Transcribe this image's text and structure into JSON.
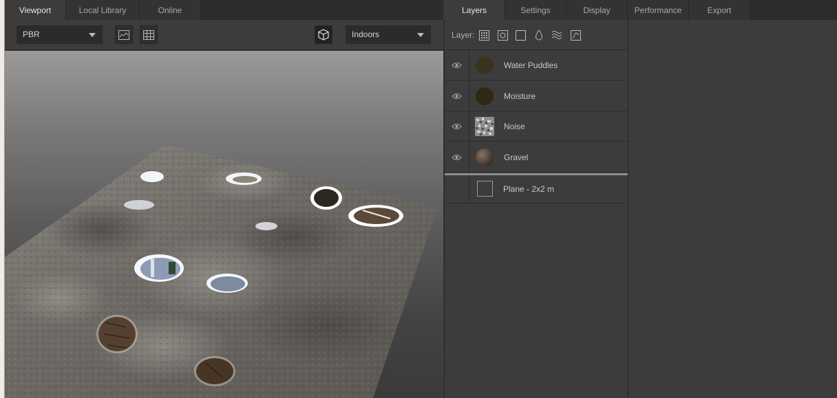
{
  "viewport_tabs": [
    {
      "label": "Viewport",
      "active": true
    },
    {
      "label": "Local Library",
      "active": false
    },
    {
      "label": "Online",
      "active": false
    }
  ],
  "toolbar": {
    "shading_mode": "PBR",
    "environment": "Indoors"
  },
  "right_tabs": [
    {
      "label": "Layers",
      "active": true
    },
    {
      "label": "Settings",
      "active": false
    },
    {
      "label": "Display",
      "active": false
    },
    {
      "label": "Performance",
      "active": false
    },
    {
      "label": "Export",
      "active": false
    }
  ],
  "layers": {
    "tools_label": "Layer:",
    "items": [
      {
        "name": "Water Puddles",
        "visible": true,
        "thumb_color": "#3b3320"
      },
      {
        "name": "Moisture",
        "visible": true,
        "thumb_color": "#2f2814"
      },
      {
        "name": "Noise",
        "visible": true,
        "thumb_color": "#9a9a9a"
      },
      {
        "name": "Gravel",
        "visible": true,
        "thumb_color": "#5e4b3c"
      }
    ],
    "base": {
      "name": "Plane - 2x2 m"
    }
  },
  "icons": {
    "histogram": "histogram-icon",
    "grid": "grid-icon",
    "cube": "cube-icon",
    "eye": "eye-icon"
  }
}
